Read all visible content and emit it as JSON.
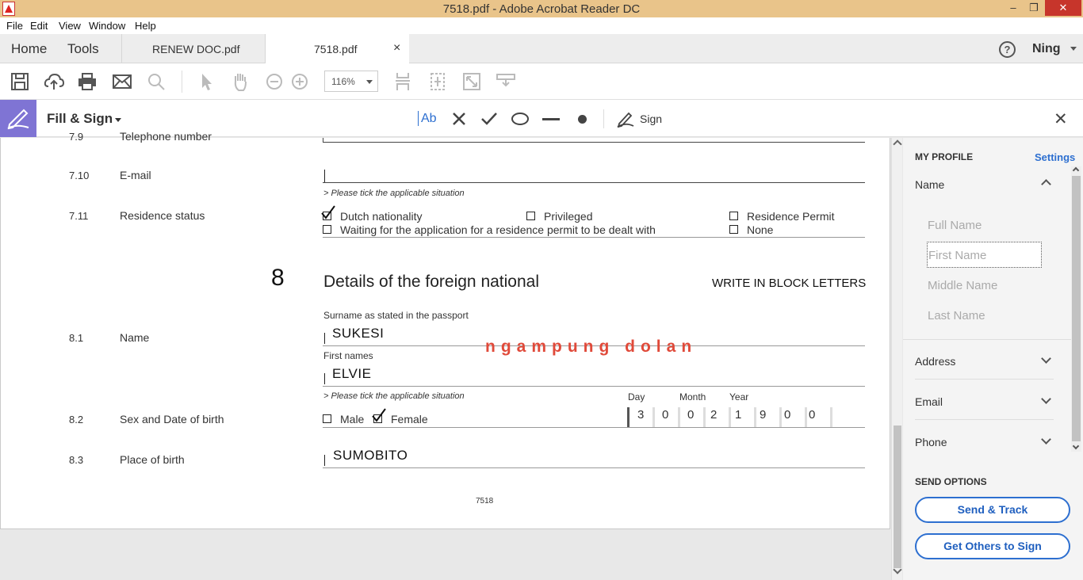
{
  "window": {
    "title": "7518.pdf - Adobe Acrobat Reader DC",
    "minimize": "–",
    "maximize": "❐",
    "close": "✕"
  },
  "menu": [
    "File",
    "Edit",
    "View",
    "Window",
    "Help"
  ],
  "tabs": {
    "home": "Home",
    "tools": "Tools",
    "doc1": "RENEW DOC.pdf",
    "doc2": "7518.pdf",
    "close": "×",
    "help": "?",
    "user": "Ning"
  },
  "toolbar": {
    "zoom": "116%"
  },
  "fillsign": {
    "title": "Fill & Sign",
    "text_tool": "Ab",
    "sign": "Sign",
    "close": "✕"
  },
  "form": {
    "row_7_9": {
      "num": "7.9",
      "label": "Telephone number"
    },
    "row_7_10": {
      "num": "7.10",
      "label": "E-mail"
    },
    "tick_hint": "> Please tick the applicable situation",
    "row_7_11": {
      "num": "7.11",
      "label": "Residence status",
      "options": [
        "Dutch nationality",
        "Privileged",
        "Residence Permit",
        "Waiting for the application for a residence permit to be dealt with",
        "None"
      ],
      "checked": "Dutch nationality"
    },
    "section": {
      "num": "8",
      "title": "Details of the foreign national",
      "note": "WRITE IN BLOCK LETTERS"
    },
    "row_8_1": {
      "num": "8.1",
      "label": "Name",
      "surname_caption": "Surname as stated in the passport",
      "surname": "SUKESI",
      "first_caption": "First names",
      "first": "ELVIE"
    },
    "watermark": "ngampung dolan",
    "row_8_2": {
      "num": "8.2",
      "label": "Sex and Date of birth",
      "male": "Male",
      "female": "Female",
      "checked": "Female",
      "day_label": "Day",
      "month_label": "Month",
      "year_label": "Year",
      "digits": [
        "3",
        "0",
        "0",
        "2",
        "1",
        "9",
        "0",
        "0"
      ]
    },
    "row_8_3": {
      "num": "8.3",
      "label": "Place of birth",
      "value": "SUMOBITO"
    },
    "page_number": "7518"
  },
  "panel": {
    "my_profile": "MY PROFILE",
    "settings": "Settings",
    "name": "Name",
    "fields": [
      "Full Name",
      "First Name",
      "Middle Name",
      "Last Name"
    ],
    "address": "Address",
    "email": "Email",
    "phone": "Phone",
    "send_options": "SEND OPTIONS",
    "send_track": "Send & Track",
    "get_others": "Get Others to Sign"
  },
  "colors": {
    "titlebar": "#e9c48a",
    "accent": "#2d6fd0",
    "fill_sign_icon": "#7f74d4",
    "watermark": "#e04a3a"
  }
}
